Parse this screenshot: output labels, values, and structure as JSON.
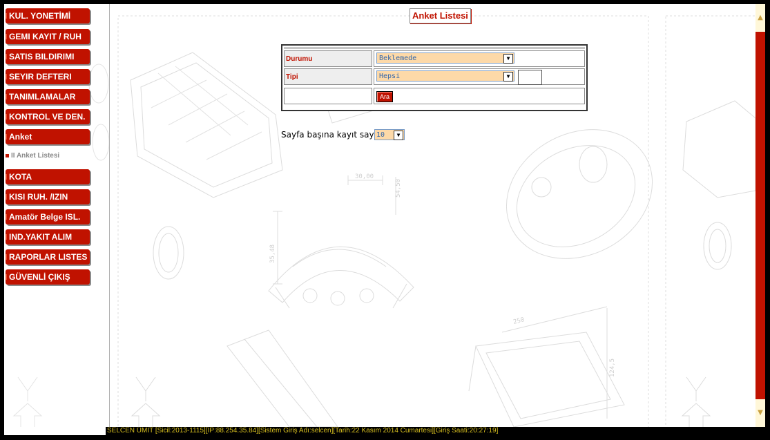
{
  "sidebar": {
    "items": [
      {
        "label": "KUL. YONETİMİ",
        "active": false
      },
      {
        "label": "GEMI KAYIT / RUH",
        "active": false
      },
      {
        "label": "SATIS BILDIRIMI",
        "active": false
      },
      {
        "label": "SEYIR DEFTERI",
        "active": false
      },
      {
        "label": "TANIMLAMALAR",
        "active": false
      },
      {
        "label": "KONTROL VE DEN.",
        "active": false
      },
      {
        "label": "Anket",
        "active": true
      },
      {
        "label": "KOTA",
        "active": false
      },
      {
        "label": "KISI RUH. /IZIN",
        "active": false
      },
      {
        "label": "Amatör Belge ISL.",
        "active": false
      },
      {
        "label": "IND.YAKIT ALIM",
        "active": false
      },
      {
        "label": "RAPORLAR LISTES",
        "active": false
      },
      {
        "label": "GÜVENLİ ÇIKIŞ",
        "active": false
      }
    ],
    "subitem": {
      "label": "II Anket Listesi"
    }
  },
  "page": {
    "title": "Anket Listesi"
  },
  "form": {
    "durum_label": "Durumu",
    "durum_value": "Beklemede",
    "tipi_label": "Tipi",
    "tipi_value": "Hepsi",
    "search_button": "Ara"
  },
  "paging": {
    "label": "Sayfa başına kayıt sayısı",
    "value": "10"
  },
  "statusbar": {
    "text": "SELCEN ÜMİT [Sicil:2013-1115][IP:88.254.35.84][Sistem Giriş Adı:selcen][Tarih:22 Kasım 2014 Cumartesi][Giriş Saati:20:27:19]"
  },
  "drawing": {
    "dim_1": "30,00",
    "dim_2": "54,50",
    "dim_3": "35,48",
    "dim_4": "250",
    "dim_5": "124,5"
  },
  "colors": {
    "accent": "#c01200",
    "select_bg": "#fdd9a8",
    "status_text": "#d8c020"
  },
  "icons": {
    "dropdown": "chevron-down-icon",
    "scroll_up": "arrow-up-icon",
    "scroll_down": "arrow-down-icon",
    "bullet": "square-bullet-icon"
  }
}
